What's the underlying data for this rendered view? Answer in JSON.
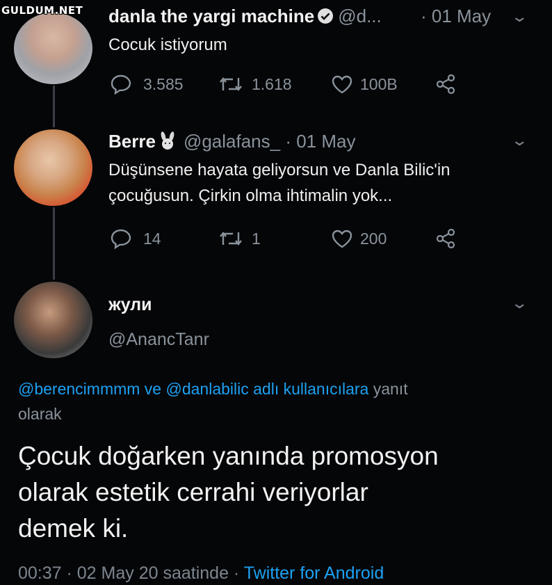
{
  "watermark": "GULDUM.NET",
  "tweet1": {
    "name": "danla the yargi machine",
    "handle": "@d...",
    "time": "· 01 May",
    "text": "Cocuk istiyorum",
    "replies": "3.585",
    "retweets": "1.618",
    "likes": "100B"
  },
  "tweet2": {
    "name": "Berre",
    "handle": "@galafans_",
    "time": "· 01 May",
    "text_line1": "Düşünsene hayata geliyorsun ve Danla Bilic'in",
    "text_line2": "çocuğusun. Çirkin olma ihtimalin yok...",
    "replies": "14",
    "retweets": "1",
    "likes": "200"
  },
  "tweet3": {
    "name": "жули",
    "handle": "@AnancTanr",
    "reply_mentions": "@berencimmmm ve @danlabilic adlı kullanıcılara",
    "reply_suffix_1": "yanıt",
    "reply_suffix_2": "olarak",
    "text_line1": "Çocuk doğarken yanında promosyon",
    "text_line2": "olarak estetik cerrahi veriyorlar",
    "text_line3": "demek ki.",
    "timestamp": "00:37 · 02 May 20 saatinde ·",
    "source": "Twitter for Android"
  },
  "colors": {
    "background": "#050608",
    "link": "#1da1f2",
    "muted": "#8a939c"
  }
}
